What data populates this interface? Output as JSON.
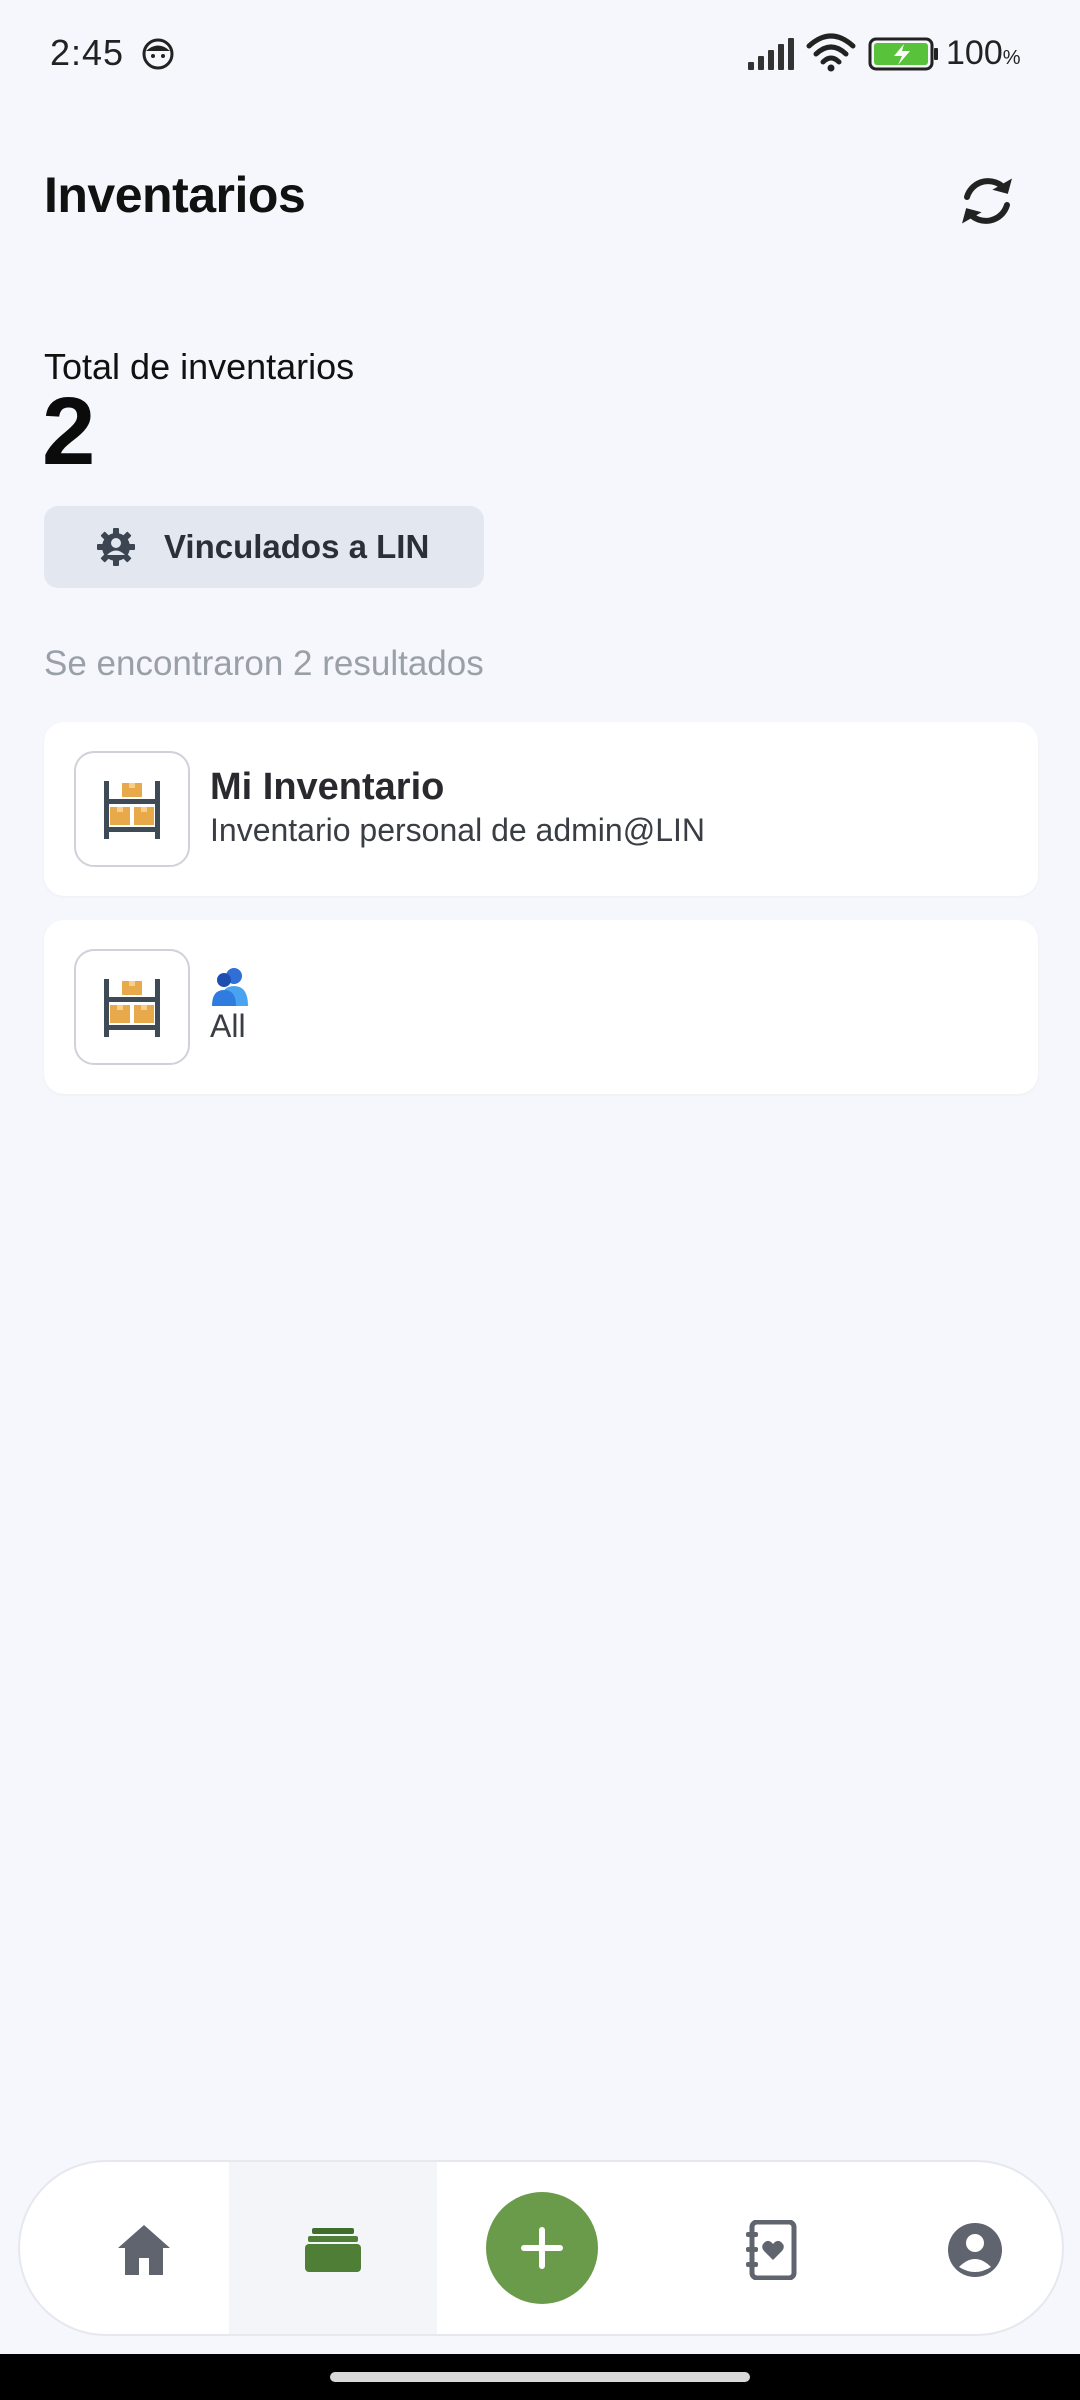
{
  "status_bar": {
    "time": "2:45",
    "battery_percent": "100",
    "battery_unit": "%"
  },
  "header": {
    "title": "Inventarios",
    "refresh_icon": "refresh-icon"
  },
  "summary": {
    "total_label": "Total de inventarios",
    "total_count": "2",
    "filter_chip_label": "Vinculados a LIN",
    "filter_icon": "gear-user-icon",
    "results_text": "Se encontraron 2 resultados"
  },
  "inventories": [
    {
      "title": "Mi Inventario",
      "subtitle": "Inventario personal de admin@LIN",
      "icon": "warehouse-shelf-icon"
    },
    {
      "title_icon": "people-icon",
      "subtitle": "All",
      "icon": "warehouse-shelf-icon"
    }
  ],
  "bottom_nav": {
    "items": [
      "home-icon",
      "inventory-stack-icon",
      "add-icon",
      "contacts-book-icon",
      "profile-icon"
    ],
    "active": "inventory-stack-icon",
    "fab_color": "#6a9b4a"
  },
  "colors": {
    "background": "#f5f7fc",
    "accent_green": "#6a9b4a",
    "chip_bg": "#e3e8f0"
  }
}
